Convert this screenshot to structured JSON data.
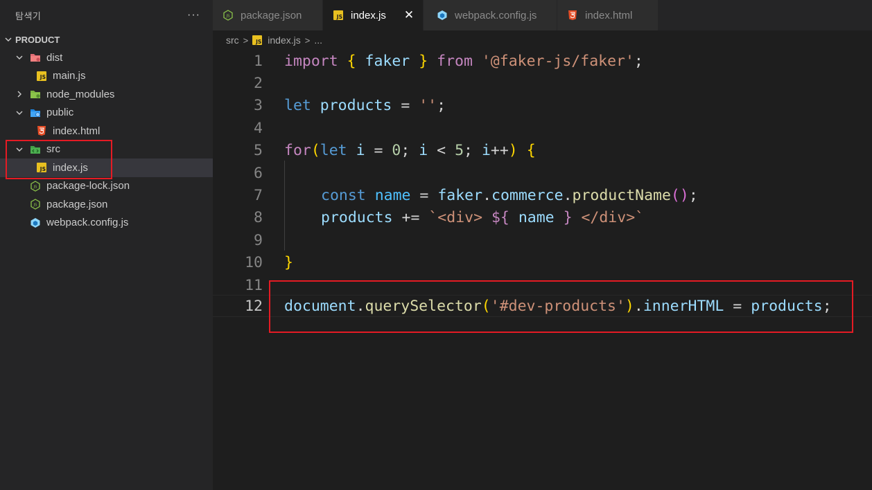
{
  "explorer": {
    "title": "탐색기",
    "more_label": "···",
    "project": "PRODUCT",
    "items": [
      {
        "label": "dist"
      },
      {
        "label": "main.js"
      },
      {
        "label": "node_modules"
      },
      {
        "label": "public"
      },
      {
        "label": "index.html"
      },
      {
        "label": "src"
      },
      {
        "label": "index.js"
      },
      {
        "label": "package-lock.json"
      },
      {
        "label": "package.json"
      },
      {
        "label": "webpack.config.js"
      }
    ]
  },
  "tabs": [
    {
      "label": "package.json"
    },
    {
      "label": "index.js"
    },
    {
      "label": "webpack.config.js"
    },
    {
      "label": "index.html"
    }
  ],
  "tab_close": "✕",
  "js_badge": "JS",
  "breadcrumb": {
    "folder": "src",
    "file": "index.js",
    "more": "..."
  },
  "editor": {
    "line_numbers": [
      "1",
      "2",
      "3",
      "4",
      "5",
      "6",
      "7",
      "8",
      "9",
      "10",
      "11",
      "12"
    ],
    "tokens": {
      "l1": [
        "import",
        "{",
        "faker",
        "}",
        "from",
        "'@faker-js/faker'",
        ";"
      ],
      "l3": [
        "let",
        "products",
        "=",
        "''",
        ";"
      ],
      "l5": [
        "for",
        "(",
        "let",
        "i",
        "=",
        "0",
        ";",
        "i",
        "<",
        "5",
        ";",
        "i",
        "++",
        ")",
        "{"
      ],
      "l7": [
        "const",
        "name",
        "=",
        "faker",
        ".",
        "commerce",
        ".",
        "productName",
        "()",
        ";"
      ],
      "l8": [
        "products",
        "+=",
        "`<div>",
        "${",
        "name",
        "}",
        "</div>`"
      ],
      "l10": [
        "}"
      ],
      "l12": [
        "document",
        ".",
        "querySelector",
        "(",
        "'#dev-products'",
        ")",
        ".",
        "innerHTML",
        "=",
        "products",
        ";"
      ]
    }
  },
  "colors": {
    "highlight_box": "#e51b24",
    "keyword": "#569cd6",
    "control": "#c586c0",
    "variable": "#9cdcfe",
    "string": "#ce9178",
    "function": "#dcdcaa"
  }
}
